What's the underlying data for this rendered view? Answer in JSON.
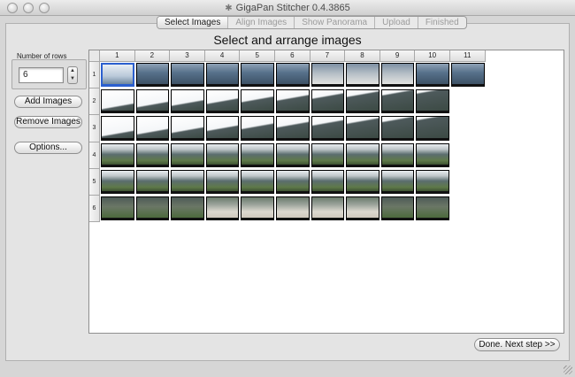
{
  "window": {
    "title": "GigaPan Stitcher 0.4.3865",
    "title_icon": "stitcher-app-icon"
  },
  "tabs": [
    {
      "label": "Select Images",
      "active": true
    },
    {
      "label": "Align Images",
      "active": false
    },
    {
      "label": "Show Panorama",
      "active": false
    },
    {
      "label": "Upload",
      "active": false
    },
    {
      "label": "Finished",
      "active": false
    }
  ],
  "heading": "Select and arrange images",
  "sidebar": {
    "rows_label": "Number of rows",
    "rows_value": "6",
    "add_images": "Add Images",
    "remove_images": "Remove Images",
    "options": "Options..."
  },
  "grid": {
    "columns": [
      "1",
      "2",
      "3",
      "4",
      "5",
      "6",
      "7",
      "8",
      "9",
      "10",
      "11"
    ],
    "rows": [
      "1",
      "2",
      "3",
      "4",
      "5",
      "6"
    ],
    "images_per_row": [
      11,
      10,
      10,
      10,
      10,
      10
    ],
    "selected_cell": {
      "row": 1,
      "col": 1
    }
  },
  "footer": {
    "next_label": "Done.  Next step >>"
  },
  "colors": {
    "selection": "#2b5fcf",
    "sky": "#dbe4ee",
    "cliff": "#5b6d6e",
    "foliage": "#5f7a4a"
  }
}
